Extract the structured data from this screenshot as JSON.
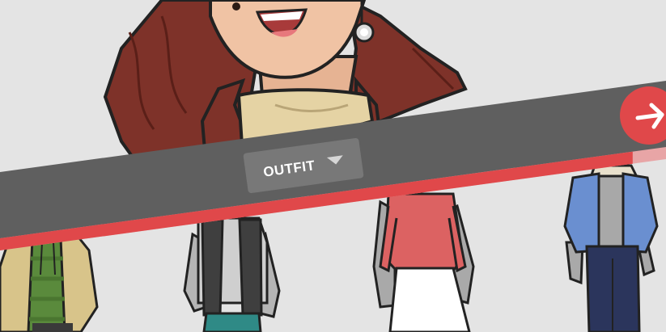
{
  "app": {
    "selector": {
      "category_label": "OUTFIT",
      "next_icon": "arrow-right-icon",
      "dropdown_icon": "caret-down-icon"
    },
    "progress": {
      "value_fraction": 0.95
    },
    "outfits": [
      {
        "name": "outfit-option-jacket-green-top"
      },
      {
        "name": "outfit-option-vest-teal-pants"
      },
      {
        "name": "outfit-option-red-top-white-skirt"
      },
      {
        "name": "outfit-option-denim-jacket"
      }
    ],
    "colors": {
      "banner": "#5f5f5f",
      "accent_red": "#e0484a",
      "progress_remaining": "#e8a5a6",
      "button_bg": "#787878",
      "background": "#e4e4e4"
    }
  }
}
